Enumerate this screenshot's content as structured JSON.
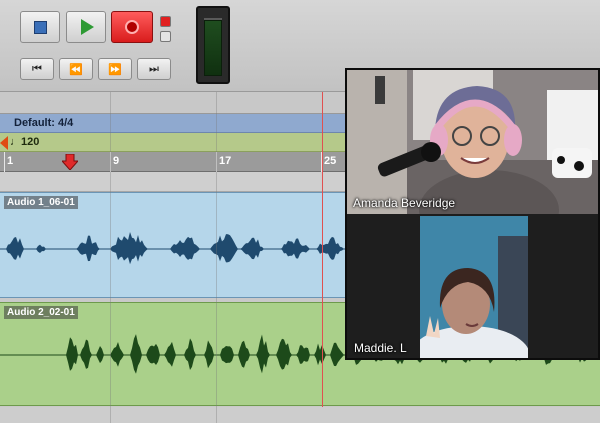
{
  "transport": {
    "buttons": [
      "stop",
      "play",
      "record",
      "rewind-to-start",
      "rewind",
      "fast-forward",
      "go-to-end"
    ],
    "icons": {
      "start": "⏮",
      "rewind": "⏪",
      "forward": "⏩",
      "end": "⏭"
    }
  },
  "ruler": {
    "meter_label": "Default: 4/4",
    "tempo_label": "♩120",
    "bar_numbers": [
      "1",
      "9",
      "17",
      "25"
    ]
  },
  "tracks": [
    {
      "clip_name": "Audio 1_06-01",
      "color": "#b5d6ea",
      "wave_color": "#1f4a6e"
    },
    {
      "clip_name": "Audio 2_02-01",
      "color": "#aad08a",
      "wave_color": "#1d4a1a"
    }
  ],
  "video_call": {
    "participants": [
      {
        "name": "Amanda Beveridge"
      },
      {
        "name": "Maddie. L"
      }
    ]
  },
  "colors": {
    "record_red": "#e02020",
    "cursor": "#e05050",
    "tempo_marker": "#e04b12"
  }
}
